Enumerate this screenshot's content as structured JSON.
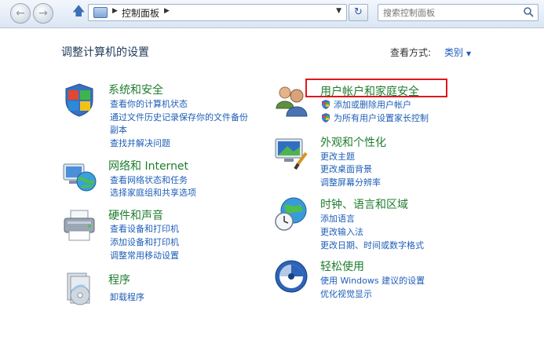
{
  "nav": {
    "back_icon": "back-arrow-icon",
    "forward_icon": "forward-arrow-icon",
    "up_icon": "up-arrow-icon",
    "breadcrumb": [
      "控制面板"
    ],
    "refresh_icon": "refresh-icon",
    "search_placeholder": "搜索控制面板"
  },
  "header": {
    "title": "调整计算机的设置",
    "view_by_label": "查看方式:",
    "view_by_value": "类别"
  },
  "categories_left": [
    {
      "title": "系统和安全",
      "icon": "shield-flag-icon",
      "links": [
        "查看你的计算机状态",
        "通过文件历史记录保存你的文件备份",
        "副本",
        "查找并解决问题"
      ]
    },
    {
      "title": "网络和 Internet",
      "icon": "network-globe-icon",
      "links": [
        "查看网络状态和任务",
        "选择家庭组和共享选项"
      ]
    },
    {
      "title": "硬件和声音",
      "icon": "printer-icon",
      "links": [
        "查看设备和打印机",
        "添加设备和打印机",
        "调整常用移动设置"
      ]
    },
    {
      "title": "程序",
      "icon": "programs-disc-icon",
      "links": [
        "卸载程序"
      ]
    }
  ],
  "categories_right": [
    {
      "title": "用户帐户和家庭安全",
      "icon": "users-icon",
      "links": [
        "添加或删除用户帐户",
        "为所有用户设置家长控制"
      ]
    },
    {
      "title": "外观和个性化",
      "icon": "monitor-brush-icon",
      "links": [
        "更改主题",
        "更改桌面背景",
        "调整屏幕分辨率"
      ]
    },
    {
      "title": "时钟、语言和区域",
      "icon": "clock-globe-icon",
      "links": [
        "添加语言",
        "更改输入法",
        "更改日期、时间或数字格式"
      ]
    },
    {
      "title": "轻松使用",
      "icon": "ease-of-access-icon",
      "links": [
        "使用 Windows 建议的设置",
        "优化视觉显示"
      ]
    }
  ],
  "colors": {
    "title_green": "#1f7d2e",
    "link_blue": "#1e5eb8",
    "highlight_red": "#e0181b"
  }
}
